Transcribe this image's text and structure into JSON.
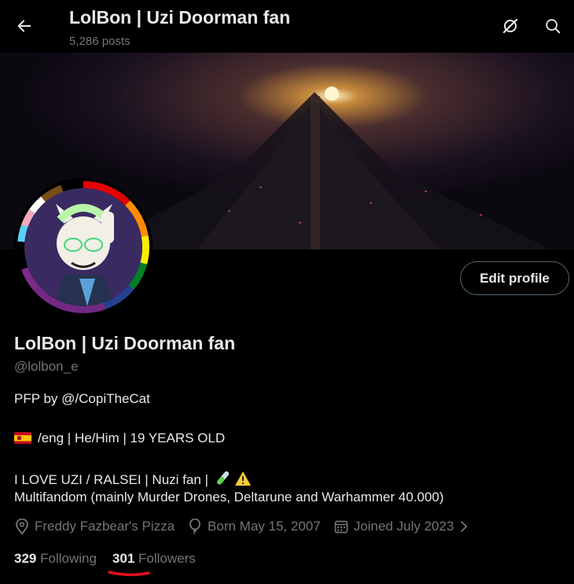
{
  "header": {
    "title": "LolBon | Uzi Doorman fan",
    "post_count": "5,286 posts"
  },
  "profile": {
    "display_name": "LolBon | Uzi Doorman fan",
    "handle": "@lolbon_e",
    "edit_button": "Edit profile",
    "bio": {
      "line1": "PFP by @/CopiTheCat",
      "line2": "/eng | He/Him | 19 YEARS OLD",
      "line3": "I LOVE UZI / RALSEI | Nuzi fan |",
      "line4": "Multifandom (mainly Murder Drones, Deltarune and Warhammer 40.000)"
    },
    "meta": {
      "location": "Freddy Fazbear's Pizza",
      "birthday": "Born May 15, 2007",
      "joined": "Joined July 2023"
    },
    "stats": {
      "following_count": "329",
      "following_label": "Following",
      "followers_count": "301",
      "followers_label": "Followers"
    }
  },
  "icons": {
    "back": "arrow-left-icon",
    "grok": "grok-icon",
    "search": "search-icon",
    "location": "location-pin-icon",
    "birthday": "balloon-icon",
    "joined": "calendar-icon",
    "chevron": "chevron-right-icon"
  },
  "colors": {
    "background": "#000000",
    "primary_text": "#e7e9ea",
    "secondary_text": "#71767b",
    "underline_annotation": "#e0101a"
  }
}
